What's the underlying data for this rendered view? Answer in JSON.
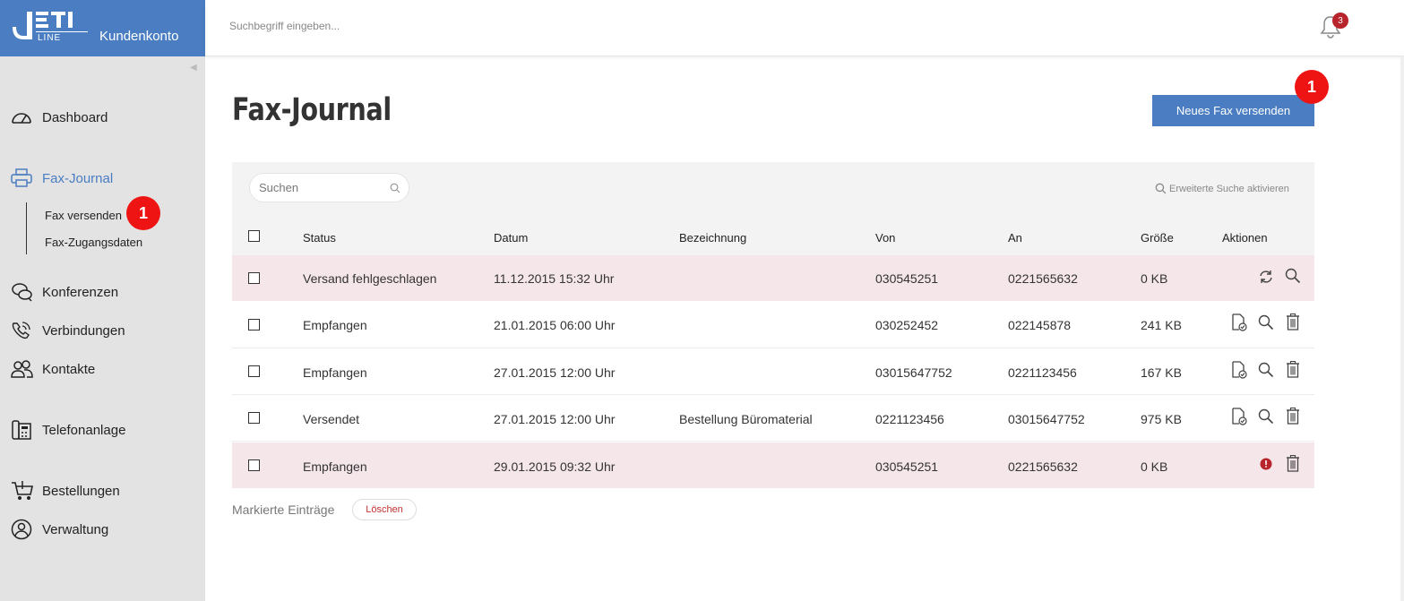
{
  "brand": {
    "logo_text": "JETI LINE",
    "subtitle": "Kundenkonto"
  },
  "header": {
    "search_placeholder": "Suchbegriff eingeben...",
    "notification_count": "3"
  },
  "sidebar": {
    "items": [
      {
        "label": "Dashboard",
        "icon": "speedometer-icon"
      },
      {
        "label": "Fax-Journal",
        "icon": "printer-icon",
        "active": true
      },
      {
        "label": "Konferenzen",
        "icon": "chat-bubbles-icon"
      },
      {
        "label": "Verbindungen",
        "icon": "phone-icon"
      },
      {
        "label": "Kontakte",
        "icon": "contacts-icon"
      },
      {
        "label": "Telefonanlage",
        "icon": "telephone-system-icon"
      },
      {
        "label": "Bestellungen",
        "icon": "cart-icon"
      },
      {
        "label": "Verwaltung",
        "icon": "user-circle-icon"
      }
    ],
    "subitems": [
      {
        "label": "Fax versenden"
      },
      {
        "label": "Fax-Zugangsdaten"
      }
    ],
    "marker": "1"
  },
  "main": {
    "title": "Fax-Journal",
    "new_fax_button": "Neues Fax versenden",
    "button_marker": "1",
    "search_placeholder": "Suchen",
    "advanced_search": "Erweiterte Suche aktivieren",
    "columns": [
      "Status",
      "Datum",
      "Bezeichnung",
      "Von",
      "An",
      "Größe",
      "Aktionen"
    ],
    "rows": [
      {
        "status": "Versand fehlgeschlagen",
        "date": "11.12.2015 15:32 Uhr",
        "label": "",
        "from": "030545251",
        "to": "0221565632",
        "size": "0 KB",
        "error": true,
        "actions": [
          "retry-icon",
          "search-icon"
        ]
      },
      {
        "status": "Empfangen",
        "date": "21.01.2015 06:00 Uhr",
        "label": "",
        "from": "030252452",
        "to": "022145878",
        "size": "241 KB",
        "error": false,
        "actions": [
          "document-check-icon",
          "search-icon",
          "trash-icon"
        ]
      },
      {
        "status": "Empfangen",
        "date": "27.01.2015 12:00 Uhr",
        "label": "",
        "from": "03015647752",
        "to": "0221123456",
        "size": "167 KB",
        "error": false,
        "actions": [
          "document-check-icon",
          "search-icon",
          "trash-icon"
        ]
      },
      {
        "status": "Versendet",
        "date": "27.01.2015 12:00 Uhr",
        "label": "Bestellung Büromaterial",
        "from": "0221123456",
        "to": "03015647752",
        "size": "975 KB",
        "error": false,
        "actions": [
          "document-check-icon",
          "search-icon",
          "trash-icon"
        ]
      },
      {
        "status": "Empfangen",
        "date": "29.01.2015 09:32 Uhr",
        "label": "",
        "from": "030545251",
        "to": "0221565632",
        "size": "0 KB",
        "error": true,
        "actions": [
          "error-icon",
          "trash-icon"
        ]
      }
    ],
    "marked_entries_label": "Markierte Einträge",
    "delete_button": "Löschen"
  },
  "colors": {
    "brand_blue": "#4a7dc1",
    "error_row": "#f5e6ea",
    "marker_red": "#ef1414",
    "badge_red": "#b8242b"
  }
}
